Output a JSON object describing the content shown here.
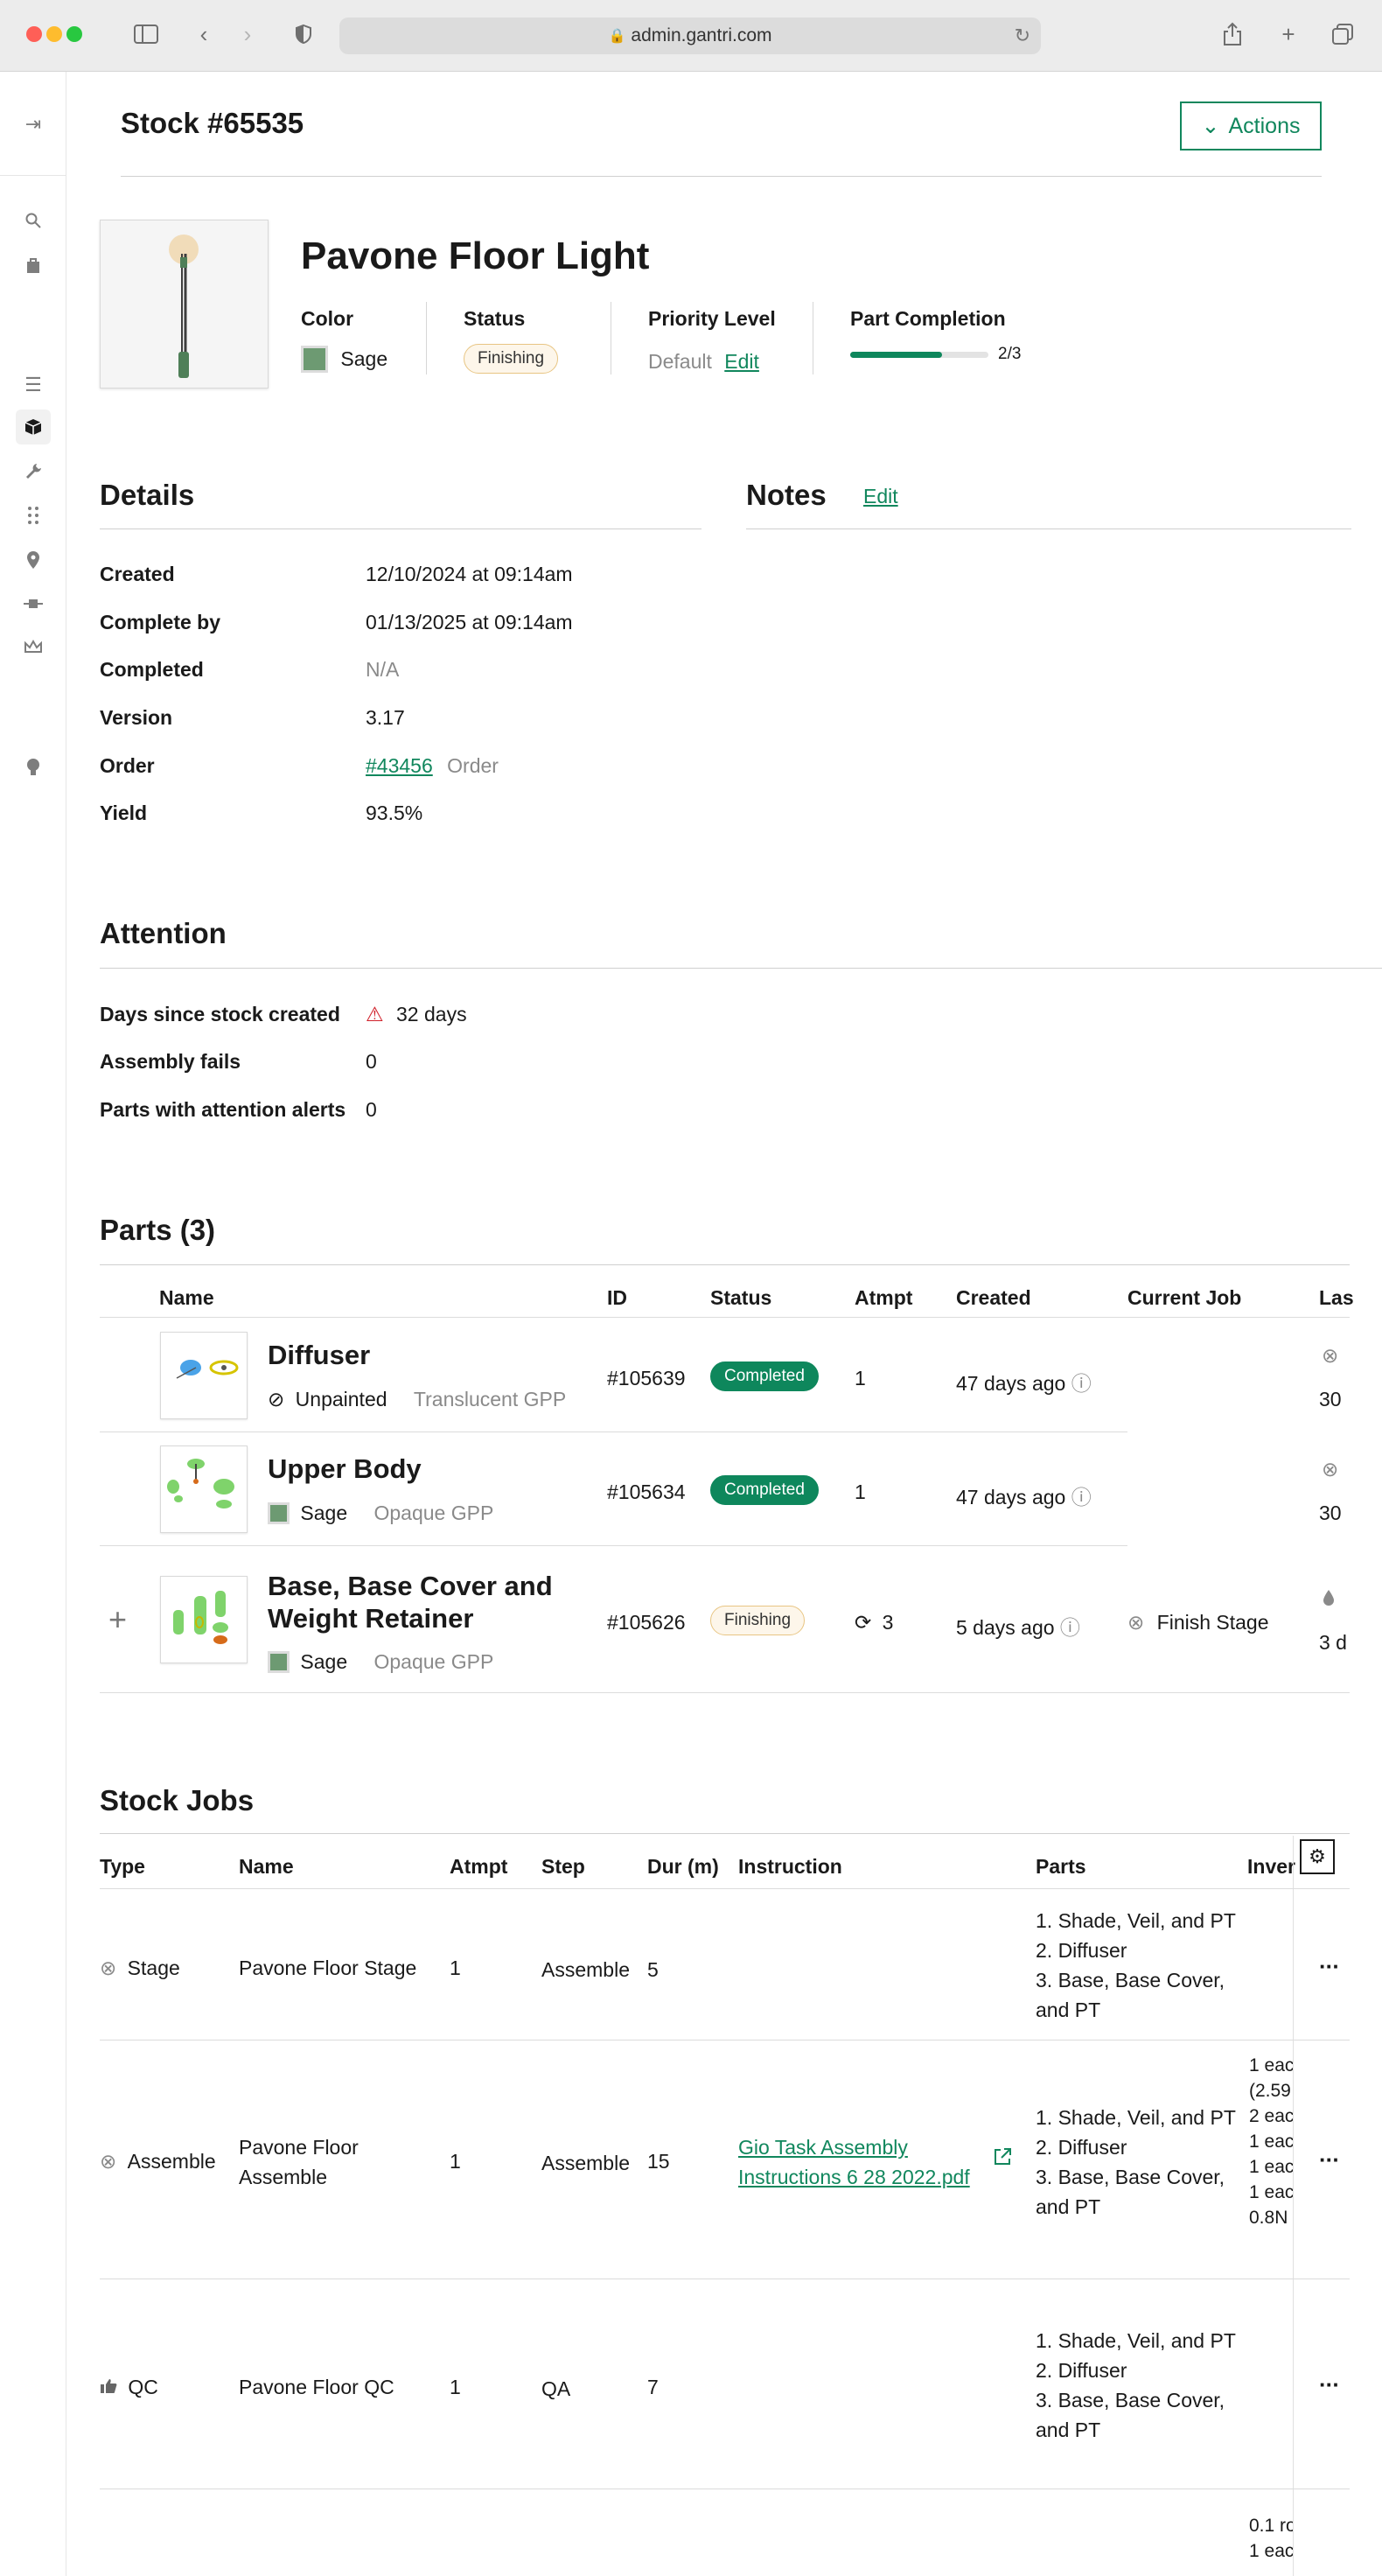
{
  "browser": {
    "url": "admin.gantri.com"
  },
  "header": {
    "title": "Stock #65535",
    "actions_label": "Actions"
  },
  "product": {
    "name": "Pavone Floor Light",
    "color_label": "Color",
    "color_value": "Sage",
    "color_hex": "#6d9a72",
    "status_label": "Status",
    "status_value": "Finishing",
    "priority_label": "Priority Level",
    "priority_value": "Default",
    "priority_edit": "Edit",
    "completion_label": "Part Completion",
    "completion_text": "2/3",
    "completion_fraction": 0.667
  },
  "details": {
    "title": "Details",
    "rows": [
      {
        "label": "Created",
        "value": "12/10/2024 at 09:14am"
      },
      {
        "label": "Complete by",
        "value": "01/13/2025 at 09:14am"
      },
      {
        "label": "Completed",
        "value": "N/A"
      },
      {
        "label": "Version",
        "value": "3.17"
      },
      {
        "label": "Order",
        "value": "#43456",
        "suffix": "Order"
      },
      {
        "label": "Yield",
        "value": "93.5%"
      }
    ]
  },
  "notes": {
    "title": "Notes",
    "edit": "Edit"
  },
  "attention": {
    "title": "Attention",
    "rows": [
      {
        "label": "Days since stock created",
        "value": "32 days"
      },
      {
        "label": "Assembly fails",
        "value": "0"
      },
      {
        "label": "Parts with attention alerts",
        "value": "0"
      }
    ]
  },
  "parts": {
    "title": "Parts (3)",
    "columns": [
      "Name",
      "ID",
      "Status",
      "Atmpt",
      "Created",
      "Current Job",
      "Las"
    ],
    "rows": [
      {
        "name": "Diffuser",
        "color": "Unpainted",
        "material": "Translucent GPP",
        "id": "#105639",
        "status": "Completed",
        "atmpt": "1",
        "created": "47 days ago",
        "current_job": "",
        "last": "30"
      },
      {
        "name": "Upper Body",
        "color": "Sage",
        "material": "Opaque GPP",
        "id": "#105634",
        "status": "Completed",
        "atmpt": "1",
        "created": "47 days ago",
        "current_job": "",
        "last": "30"
      },
      {
        "name_line1": "Base, Base Cover and",
        "name_line2": "Weight Retainer",
        "color": "Sage",
        "material": "Opaque GPP",
        "id": "#105626",
        "status": "Finishing",
        "atmpt": "3",
        "created": "5 days ago",
        "current_job": "Finish Stage",
        "last": "3 d"
      }
    ]
  },
  "stock_jobs": {
    "title": "Stock Jobs",
    "columns": [
      "Type",
      "Name",
      "Atmpt",
      "Step",
      "Dur (m)",
      "Instruction",
      "Parts",
      "Inver"
    ],
    "rows": [
      {
        "type": "Stage",
        "name": "Pavone Floor Stage",
        "atmpt": "1",
        "step": "Assemble",
        "dur": "5",
        "instruction": "",
        "parts": [
          "1. Shade, Veil, and PT",
          "2. Diffuser",
          "3. Base, Base Cover,",
          "and PT"
        ],
        "inventory": []
      },
      {
        "type": "Assemble",
        "name_line1": "Pavone Floor",
        "name_line2": "Assemble",
        "atmpt": "1",
        "step": "Assemble",
        "dur": "15",
        "instruction_line1": "Gio Task Assembly",
        "instruction_line2": "Instructions 6 28 2022.pdf",
        "parts": [
          "1. Shade, Veil, and PT",
          "2. Diffuser",
          "3. Base, Base Cover,",
          "and PT"
        ],
        "inventory": [
          "1 eac",
          "(2.59",
          "2 eac",
          "1 eac",
          "1 eac",
          "1 eac",
          "0.8N"
        ]
      },
      {
        "type": "QC",
        "name": "Pavone Floor QC",
        "atmpt": "1",
        "step": "QA",
        "dur": "7",
        "instruction": "",
        "parts": [
          "1. Shade, Veil, and PT",
          "2. Diffuser",
          "3. Base, Base Cover,",
          "and PT"
        ],
        "inventory": []
      }
    ],
    "partial_row_inventory": [
      "0.1 ro",
      "1 eac"
    ]
  },
  "icons": {
    "rail": [
      "collapse-icon",
      "search-icon",
      "bag-icon",
      "list-icon",
      "box-icon",
      "wrench-icon",
      "grid-dots-icon",
      "location-pin-icon",
      "plug-icon",
      "crown-icon",
      "lightbulb-icon"
    ]
  },
  "colors": {
    "accent": "#11875d",
    "sage": "#6d9a72"
  }
}
